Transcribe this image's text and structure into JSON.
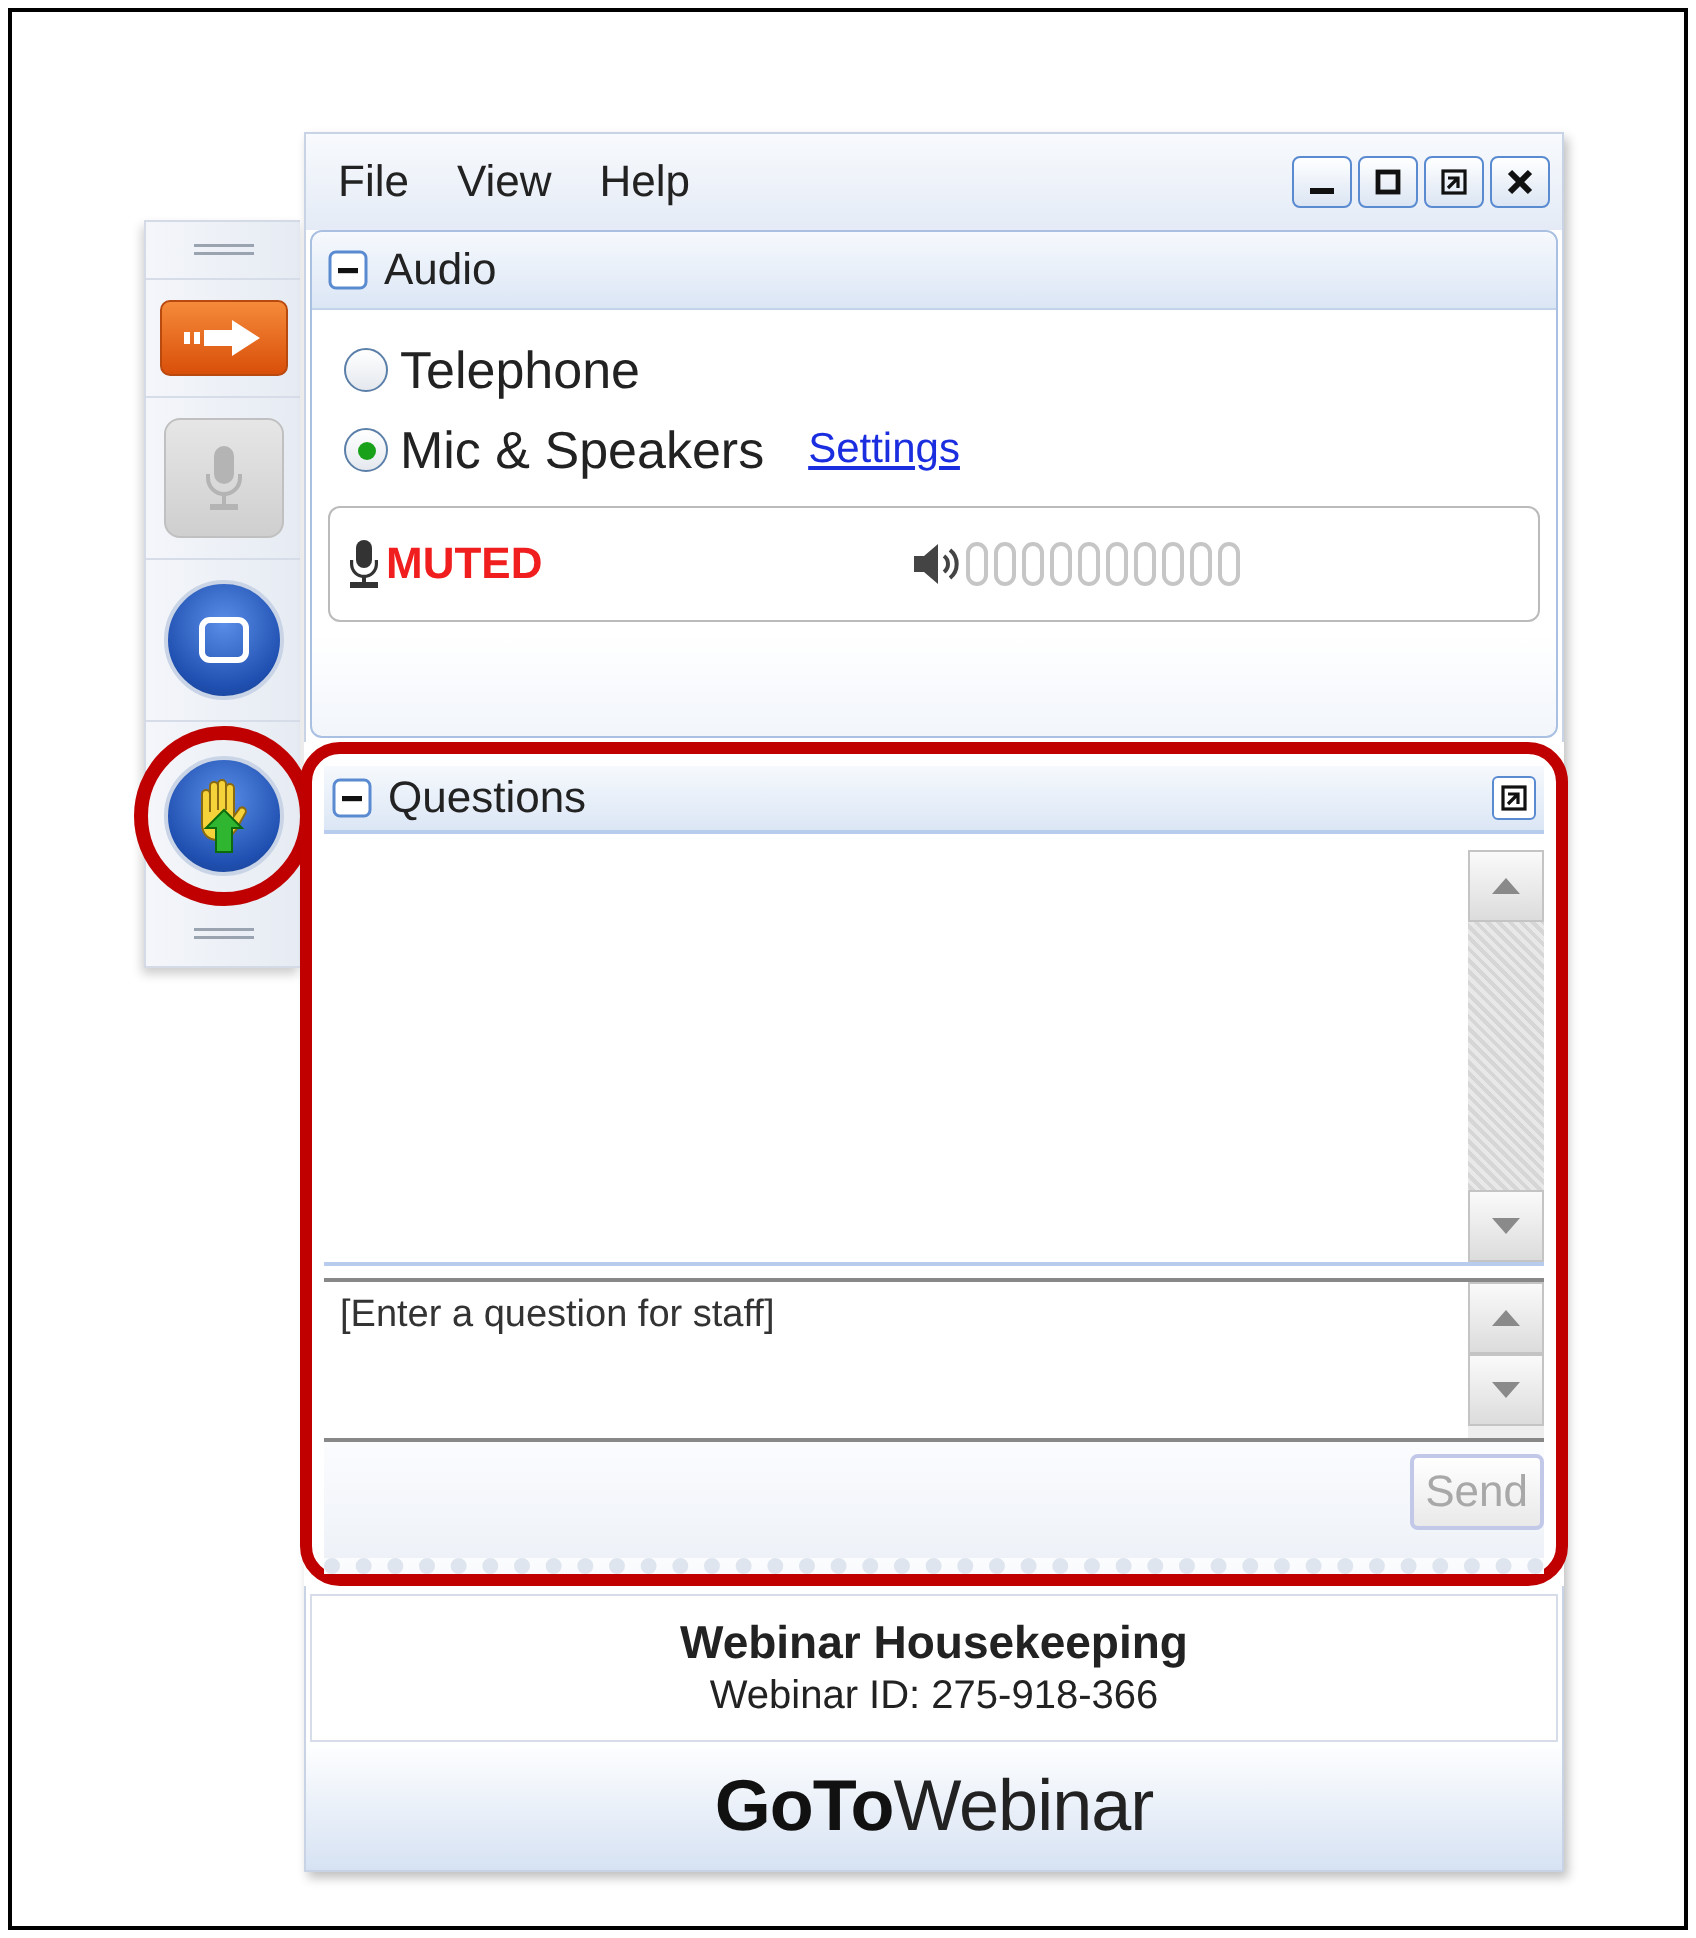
{
  "menu": [
    "File",
    "View",
    "Help"
  ],
  "sidebar": {
    "buttons": [
      {
        "kind": "arrow",
        "disabled": false,
        "highlighted": false
      },
      {
        "kind": "mic",
        "disabled": true,
        "highlighted": false
      },
      {
        "kind": "screen",
        "disabled": false,
        "highlighted": false
      },
      {
        "kind": "hand",
        "disabled": false,
        "highlighted": true
      }
    ]
  },
  "audio": {
    "title": "Audio",
    "expanded": true,
    "options": [
      {
        "label": "Telephone",
        "selected": false
      },
      {
        "label": "Mic & Speakers",
        "selected": true
      }
    ],
    "settings_link": "Settings",
    "mic_status": "MUTED"
  },
  "questions": {
    "title": "Questions",
    "expanded": true,
    "highlighted": true,
    "input": {
      "placeholder": "[Enter a question for staff]"
    },
    "send": {
      "label": "Send",
      "disabled": true
    }
  },
  "info": {
    "title": "Webinar Housekeeping",
    "id_line": "Webinar ID: 275-918-366"
  },
  "logo": "**GoTo**Webinar"
}
